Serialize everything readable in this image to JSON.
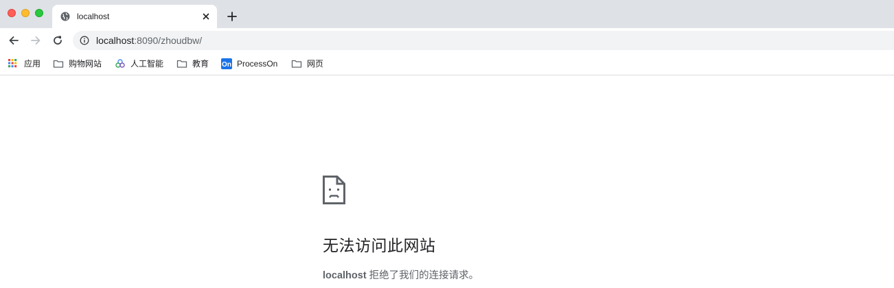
{
  "tab": {
    "title": "localhost",
    "favicon": "globe-icon"
  },
  "toolbar": {
    "url_host": "localhost",
    "url_path": ":8090/zhoudbw/"
  },
  "bookmarks": [
    {
      "label": "应用",
      "icon": "apps-grid-icon"
    },
    {
      "label": "购物网站",
      "icon": "folder-icon"
    },
    {
      "label": "人工智能",
      "icon": "ai-logo-icon"
    },
    {
      "label": "教育",
      "icon": "folder-icon"
    },
    {
      "label": "ProcessOn",
      "icon": "processon-logo-icon",
      "badge": "On"
    },
    {
      "label": "网页",
      "icon": "folder-icon"
    }
  ],
  "error": {
    "title": "无法访问此网站",
    "host": "localhost",
    "message": " 拒绝了我们的连接请求。"
  },
  "colors": {
    "tabstrip": "#dee1e6",
    "omnibox": "#f1f3f4",
    "text": "#202124",
    "muted": "#5f6368",
    "processon_blue": "#1a73e8"
  }
}
